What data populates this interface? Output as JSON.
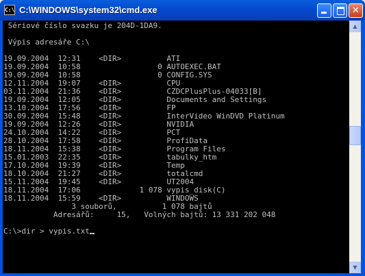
{
  "window": {
    "icon_text": "C:\\",
    "title": "C:\\WINDOWS\\system32\\cmd.exe",
    "buttons": {
      "minimize": "minimize",
      "maximize": "maximize",
      "close": "✕"
    }
  },
  "console": {
    "lines": [
      " Sériové číslo svazku je 204D-1DA9.",
      "",
      " Výpis adresáře C:\\",
      "",
      "19.09.2004  12:31    <DIR>          ATI",
      "19.09.2004  10:58                 0 AUTOEXEC.BAT",
      "19.09.2004  10:58                 0 CONFIG.SYS",
      "12.11.2004  19:07    <DIR>          CPU",
      "03.11.2004  21:36    <DIR>          CZDCPlusPlus-04033[B]",
      "19.09.2004  12:05    <DIR>          Documents and Settings",
      "13.10.2004  17:56    <DIR>          FP",
      "30.09.2004  15:48    <DIR>          InterVideo WinDVD Platinum",
      "19.09.2004  12:26    <DIR>          NVIDIA",
      "24.10.2004  14:22    <DIR>          PCT",
      "28.10.2004  17:58    <DIR>          ProfiData",
      "18.11.2004  15:38    <DIR>          Program Files",
      "15.01.2003  22:35    <DIR>          tabulky_htm",
      "17.10.2004  19:39    <DIR>          Temp",
      "18.10.2004  21:27    <DIR>          totalcmd",
      "15.11.2004  19:45    <DIR>          UT2004",
      "18.11.2004  17:06             1 078 vypis_disk(C)",
      "18.11.2004  15:59    <DIR>          WINDOWS",
      "               3 souborů,          1 078 bajtů",
      "           Adresářů:     15,   Volných bajtů: 13 331 202 048",
      "",
      "C:\\>dir > vypis.txt"
    ]
  },
  "scrollbar": {
    "up_arrow": "▲",
    "down_arrow": "▼"
  }
}
